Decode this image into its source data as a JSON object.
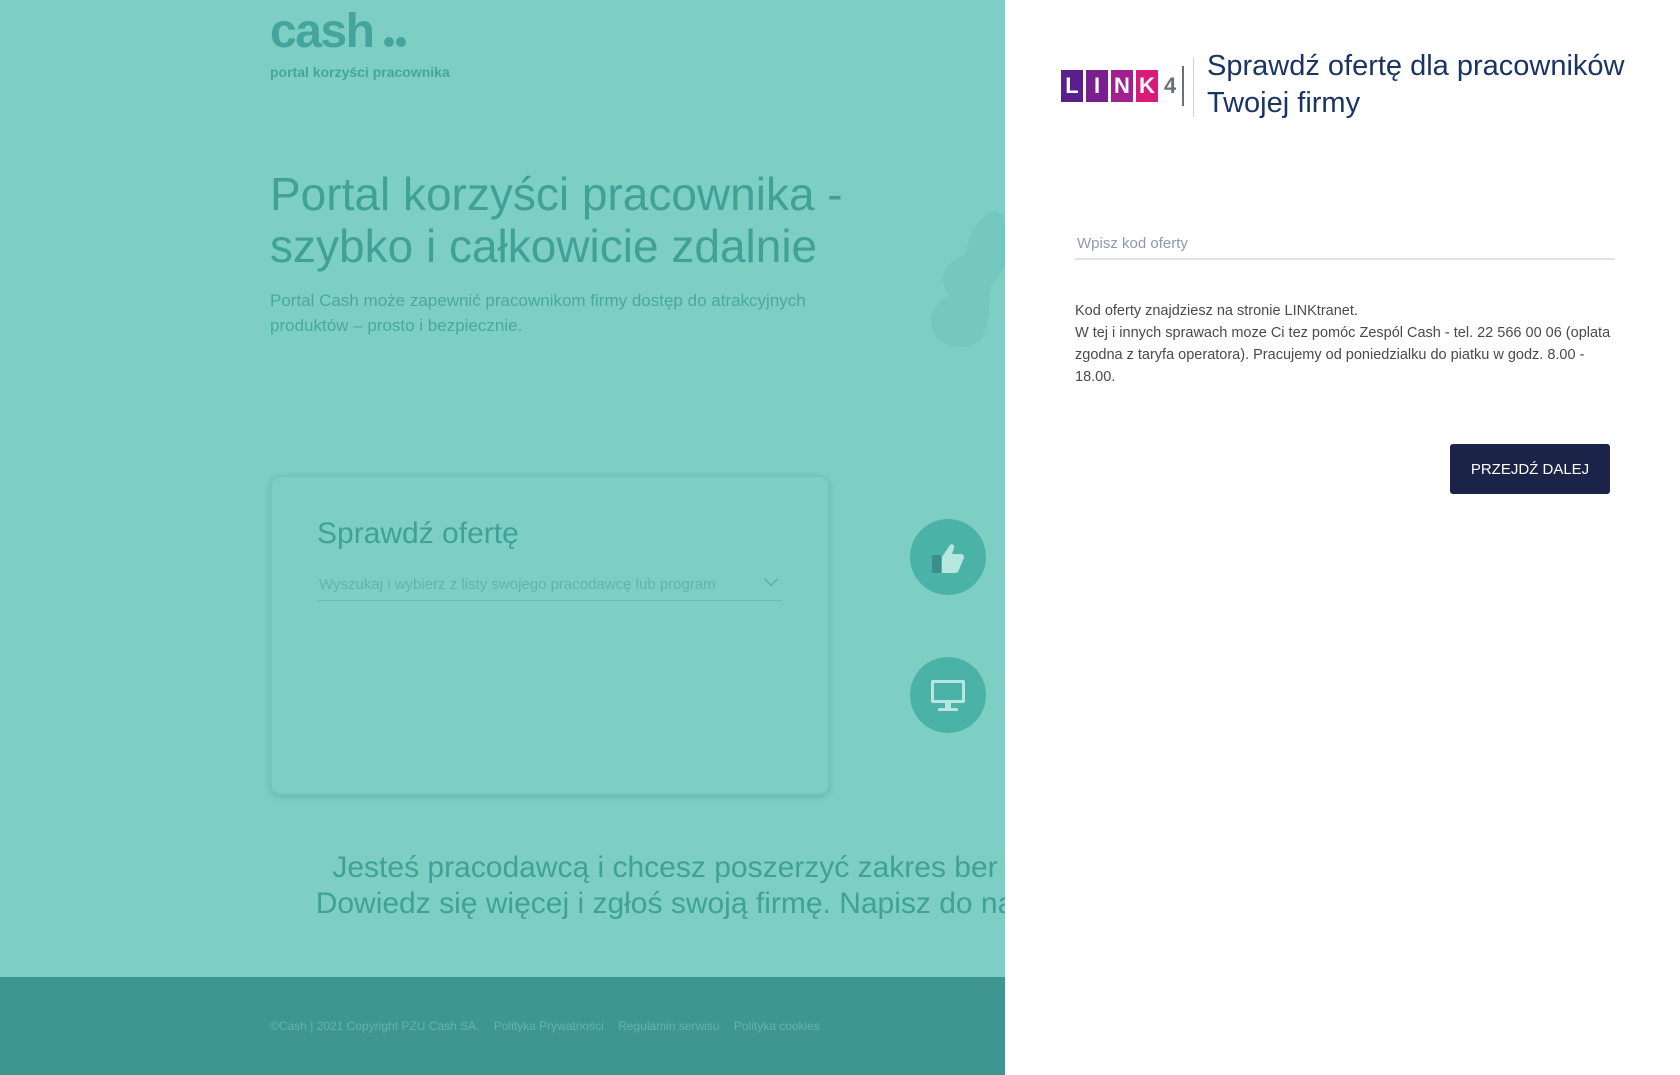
{
  "brand": {
    "logo_text": "cash",
    "tagline": "portal korzyści pracownika"
  },
  "hero": {
    "title": "Portal korzyści pracownika - szybko i całkowicie zdalnie",
    "subtitle": "Portal Cash może zapewnić pracownikom firmy dostęp do atrakcyjnych produktów – prosto i bezpiecznie."
  },
  "search_card": {
    "title": "Sprawdź ofertę",
    "select_placeholder": "Wyszukaj i wybierz z listy swojego pracodawcę lub program"
  },
  "features": [
    {
      "icon": "thumbs-up-icon"
    },
    {
      "icon": "monitor-icon"
    }
  ],
  "employer_cta": {
    "line1": "Jesteś pracodawcą i chcesz poszerzyć zakres ber",
    "line2": "Dowiedz się więcej i zgłoś swoją firmę. Napisz do na"
  },
  "footer": {
    "copyright": "©Cash | 2021 Copyright PZU Cash SA.",
    "privacy": "Polityka Prywatności",
    "terms": "Regulamin serwisu",
    "cookies": "Polityka cookies"
  },
  "panel": {
    "partner_logo": {
      "letters": [
        "L",
        "I",
        "N",
        "K"
      ],
      "number": "4",
      "letter_colors": [
        "#5a1f8c",
        "#7a1f8e",
        "#a11f8f",
        "#d81b7a"
      ]
    },
    "title": "Sprawdź ofertę dla pracowników Twojej firmy",
    "code_placeholder": "Wpisz kod oferty",
    "code_value": "",
    "info_line1": "Kod oferty znajdziesz na stronie LINKtranet.",
    "info_line2": "W tej i innych sprawach moze Ci tez pomóc Zespól Cash - tel. 22 566 00 06 (oplata zgodna z taryfa operatora). Pracujemy od poniedzialku do piatku w godz. 8.00 - 18.00.",
    "submit_label": "PRZEJDŹ DALEJ"
  },
  "colors": {
    "background_teal": "#7dcfc4",
    "footer_teal": "#3e9592",
    "panel_title": "#1a3466",
    "button_navy": "#1b2448"
  }
}
